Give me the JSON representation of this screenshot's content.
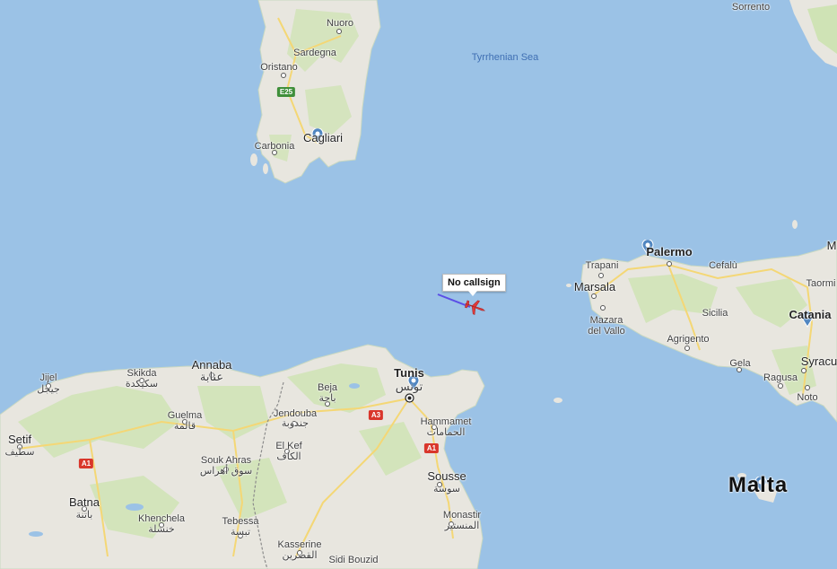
{
  "sea_label": "Tyrrhenian Sea",
  "callout": "No callsign",
  "colors": {
    "water": "#9bc2e6",
    "land": "#e8e6df",
    "vegetation": "#cfe3b5",
    "road": "#f4d775",
    "border": "#8c8c8c",
    "pin": "#5086c1",
    "aircraft": "#e03b3b",
    "track": "#5b4ee6"
  },
  "places": {
    "sorrento": "Sorrento",
    "nuoro": "Nuoro",
    "sardegna": "Sardegna",
    "oristano": "Oristano",
    "carbonia": "Carbonia",
    "cagliari": "Cagliari",
    "palermo": "Palermo",
    "trapani": "Trapani",
    "cefalu": "Cefalù",
    "marsala": "Marsala",
    "mazara": "Mazara\ndel Vallo",
    "sicilia": "Sicilia",
    "agrigento": "Agrigento",
    "gela": "Gela",
    "ragusa": "Ragusa",
    "noto": "Noto",
    "catania": "Catania",
    "taormina": "Taormi",
    "siracusa": "Syracu",
    "malta": "Malta",
    "tunis": "Tunis",
    "tunis_ar": "تونس",
    "hammamet": "Hammamet",
    "hammamet_ar": "الحمامات",
    "sousse": "Sousse",
    "sousse_ar": "سوسة",
    "monastir": "Monastir",
    "monastir_ar": "المنستير",
    "beja": "Beja",
    "beja_ar": "باجة",
    "jendouba": "Jendouba",
    "jendouba_ar": "جندوبة",
    "elkef": "El Kef",
    "elkef_ar": "الكاف",
    "kasserine": "Kasserine",
    "kasserine_ar": "القصرين",
    "sidibouzid": "Sidi Bouzid",
    "annaba": "Annaba",
    "annaba_ar": "عنابة",
    "skikda": "Skikda",
    "skikda_ar": "سكيكدة",
    "jijel": "Jijel",
    "jijel_ar": "جيجل",
    "guelma": "Guelma",
    "guelma_ar": "قالمة",
    "soukahras": "Souk Ahras",
    "soukahras_ar": "سوق أهراس",
    "setif": "Setif",
    "setif_ar": "سطيف",
    "batna": "Batna",
    "batna_ar": "باتنة",
    "khenchela": "Khenchela",
    "khenchela_ar": "خنشلة",
    "tebessa": "Tebessa",
    "tebessa_ar": "تبسة",
    "m": "M"
  },
  "shields": {
    "e25": "E25",
    "a3": "A3",
    "a1_tn": "A1",
    "a1_dz": "A1"
  }
}
